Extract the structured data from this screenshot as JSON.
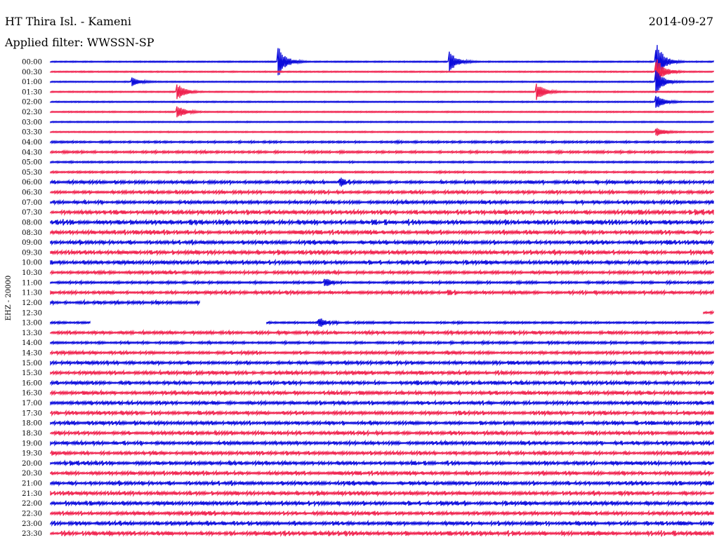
{
  "header": {
    "station": "HT Thira Isl. - Kameni",
    "filter": "Applied filter: WWSSN-SP",
    "date": "2014-09-27"
  },
  "channel_label": "EHZ - 20000",
  "colors": {
    "even_trace": "#0b0bdc",
    "odd_trace": "#f0234f",
    "background": "#ffffff",
    "text": "#000000"
  },
  "chart_data": {
    "type": "line",
    "subtype": "helicorder",
    "title": "HT Thira Isl. - Kameni",
    "subtitle": "Applied filter: WWSSN-SP",
    "date": "2014-09-27",
    "ylabel": "EHZ - 20000",
    "xlabel": "",
    "trace_colors_alternate": [
      "#0b0bdc",
      "#f0234f"
    ],
    "grid": false,
    "time_labels": [
      "00:00",
      "00:30",
      "01:00",
      "01:30",
      "02:00",
      "02:30",
      "03:00",
      "03:30",
      "04:00",
      "04:30",
      "05:00",
      "05:30",
      "06:00",
      "06:30",
      "07:00",
      "07:30",
      "08:00",
      "08:30",
      "09:00",
      "09:30",
      "10:00",
      "10:30",
      "11:00",
      "11:30",
      "12:00",
      "12:30",
      "13:00",
      "13:30",
      "14:00",
      "14:30",
      "15:00",
      "15:30",
      "16:00",
      "16:30",
      "17:00",
      "17:30",
      "18:00",
      "18:30",
      "19:00",
      "19:30",
      "20:00",
      "20:30",
      "21:00",
      "21:30",
      "22:00",
      "22:30",
      "23:00",
      "23:30"
    ],
    "noise_level": [
      0.12,
      0.12,
      0.12,
      0.13,
      0.13,
      0.13,
      0.13,
      0.14,
      0.45,
      0.55,
      0.3,
      0.38,
      0.85,
      0.85,
      0.95,
      1.3,
      1.4,
      1.2,
      1.1,
      1.2,
      1.1,
      0.85,
      0.6,
      0.85,
      0.85,
      0.9,
      0.45,
      0.9,
      0.6,
      0.8,
      0.95,
      1.0,
      1.05,
      1.05,
      1.0,
      1.05,
      1.05,
      1.05,
      1.05,
      1.05,
      1.05,
      1.1,
      1.1,
      1.1,
      1.15,
      1.1,
      1.15,
      1.25
    ],
    "gaps": [
      {
        "row": 24,
        "from": 0.225,
        "to": 1.0
      },
      {
        "row": 25,
        "from": 0.0,
        "to": 0.985
      },
      {
        "row": 26,
        "from": 0.06,
        "to": 0.325
      }
    ],
    "events": [
      {
        "row": 0,
        "x": 0.344,
        "amplitude": 7.0
      },
      {
        "row": 0,
        "x": 0.603,
        "amplitude": 4.5
      },
      {
        "row": 0,
        "x": 0.915,
        "amplitude": 8.0
      },
      {
        "row": 1,
        "x": 0.915,
        "amplitude": 6.0
      },
      {
        "row": 2,
        "x": 0.123,
        "amplitude": 2.0
      },
      {
        "row": 2,
        "x": 0.915,
        "amplitude": 5.0
      },
      {
        "row": 3,
        "x": 0.192,
        "amplitude": 3.5
      },
      {
        "row": 3,
        "x": 0.735,
        "amplitude": 3.5
      },
      {
        "row": 4,
        "x": 0.915,
        "amplitude": 3.0
      },
      {
        "row": 5,
        "x": 0.192,
        "amplitude": 3.0
      },
      {
        "row": 7,
        "x": 0.915,
        "amplitude": 2.0
      },
      {
        "row": 12,
        "x": 0.438,
        "amplitude": 2.0
      },
      {
        "row": 22,
        "x": 0.415,
        "amplitude": 1.8
      },
      {
        "row": 23,
        "x": 0.6,
        "amplitude": 2.0
      },
      {
        "row": 24,
        "x": 0.344,
        "amplitude": 4.0
      },
      {
        "row": 24,
        "x": 0.898,
        "amplitude": 2.0
      },
      {
        "row": 26,
        "x": 0.405,
        "amplitude": 2.5
      }
    ]
  }
}
